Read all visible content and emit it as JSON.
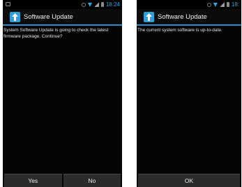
{
  "left_screen": {
    "status": {
      "time": "18:24"
    },
    "title": "Software Update",
    "message": "System Software Update is going to check the latest firmware package. Continue?",
    "buttons": {
      "yes": "Yes",
      "no": "No"
    }
  },
  "right_screen": {
    "status": {
      "time": "18:"
    },
    "title": "Software Update",
    "message": "The current system software is up-to-date.",
    "buttons": {
      "ok": "OK"
    }
  },
  "colors": {
    "accent": "#2ea7e0",
    "screen_bg": "#050505",
    "button_bg": "#2b2b2b",
    "text": "#e6e6e6"
  },
  "icons": {
    "app": "upload-arrow-icon",
    "status": [
      "alarm-icon",
      "wifi-icon",
      "signal-icon",
      "battery-icon",
      "notification-icon"
    ]
  }
}
